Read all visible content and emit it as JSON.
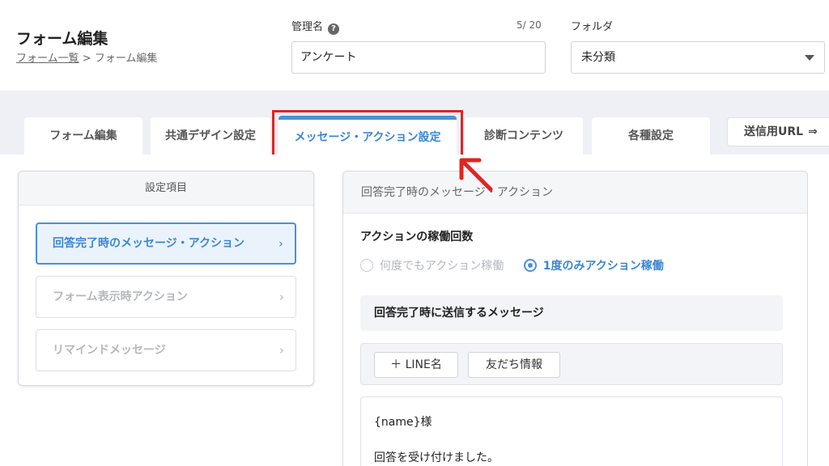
{
  "header": {
    "title": "フォーム編集",
    "breadcrumb": {
      "link": "フォーム一覧",
      "sep": ">",
      "current": "フォーム編集"
    },
    "name_field": {
      "label": "管理名",
      "help": "?",
      "counter": "5/ 20",
      "value": "アンケート"
    },
    "folder_field": {
      "label": "フォルダ",
      "value": "未分類"
    }
  },
  "tabs": [
    {
      "label": "フォーム編集"
    },
    {
      "label": "共通デザイン設定"
    },
    {
      "label": "メッセージ・アクション設定"
    },
    {
      "label": "診断コンテンツ"
    },
    {
      "label": "各種設定"
    }
  ],
  "send_url": {
    "label": "送信用URL",
    "icon": "send-icon"
  },
  "left_panel": {
    "title": "設定項目",
    "items": [
      {
        "label": "回答完了時のメッセージ・アクション"
      },
      {
        "label": "フォーム表示時アクション"
      },
      {
        "label": "リマインドメッセージ"
      }
    ]
  },
  "right_panel": {
    "title": "回答完了時のメッセージ・アクション",
    "action_count": {
      "title": "アクションの稼働回数",
      "options": [
        "何度でもアクション稼働",
        "1度のみアクション稼働"
      ],
      "selected": "1度のみアクション稼働"
    },
    "message": {
      "title": "回答完了時に送信するメッセージ",
      "buttons": [
        "＋ LINE名",
        "友だち情報"
      ],
      "lines": [
        "{name}様",
        "回答を受け付けました。"
      ]
    }
  },
  "colors": {
    "accent": "#4a90d9",
    "highlight": "#e02424"
  }
}
